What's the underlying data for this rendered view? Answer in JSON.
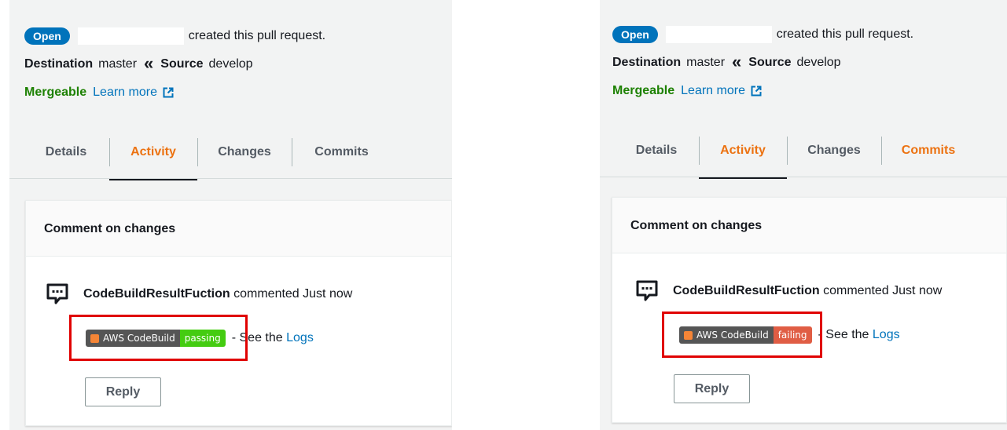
{
  "panels": [
    {
      "status_badge": "Open",
      "created_text": "created this pull request.",
      "destination_label": "Destination",
      "destination_branch": "master",
      "arrow": "«",
      "source_label": "Source",
      "source_branch": "develop",
      "mergeable": "Mergeable",
      "learn_more": "Learn more",
      "tabs": [
        "Details",
        "Activity",
        "Changes",
        "Commits"
      ],
      "active_tab": "Activity",
      "card_title": "Comment on changes",
      "commenter": "CodeBuildResultFuction",
      "comment_suffix": "commented Just now",
      "badge_left": "AWS CodeBuild",
      "badge_status": "passing",
      "see_prefix": "- See the",
      "logs_link": "Logs",
      "reply": "Reply"
    },
    {
      "status_badge": "Open",
      "created_text": "created this pull request.",
      "destination_label": "Destination",
      "destination_branch": "master",
      "arrow": "«",
      "source_label": "Source",
      "source_branch": "develop",
      "mergeable": "Mergeable",
      "learn_more": "Learn more",
      "tabs": [
        "Details",
        "Activity",
        "Changes",
        "Commits"
      ],
      "active_tab": "Activity",
      "card_title": "Comment on changes",
      "commenter": "CodeBuildResultFuction",
      "comment_suffix": "commented Just now",
      "badge_left": "AWS CodeBuild",
      "badge_status": "failing",
      "see_prefix": "- See the",
      "logs_link": "Logs",
      "reply": "Reply"
    }
  ],
  "colors": {
    "open_badge": "#0073bb",
    "mergeable": "#1d8102",
    "link": "#0073bb",
    "active_tab": "#ec7211",
    "badge_passing": "#44cc11",
    "badge_failing": "#e05d44",
    "highlight_box": "#e00000"
  }
}
